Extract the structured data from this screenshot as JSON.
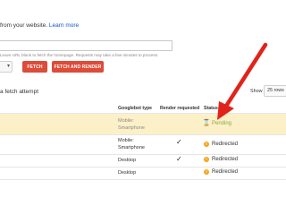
{
  "intro": {
    "text": "from your website.",
    "link": "Learn more"
  },
  "fetch_form": {
    "url_value": "",
    "hint": "Leave URL blank to fetch the homepage. Requests may take a few minutes to process.",
    "device_value": "",
    "fetch_label": "FETCH",
    "fetch_render_label": "FETCH AND RENDER"
  },
  "history": {
    "caption": "a fetch attempt",
    "show_label": "Show",
    "rows_per_page": "25 rows"
  },
  "table": {
    "columns": [
      "Googlebot type",
      "Render requested",
      "Status"
    ],
    "rows": [
      {
        "type_line1": "Mobile:",
        "type_line2": "Smartphone",
        "render": "",
        "status": "Pending",
        "status_kind": "pending"
      },
      {
        "type_line1": "Mobile:",
        "type_line2": "Smartphone",
        "render": "✓",
        "status": "Redirected",
        "status_kind": "warning"
      },
      {
        "type_line1": "Desktop",
        "type_line2": "",
        "render": "✓",
        "status": "Redirected",
        "status_kind": "warning"
      },
      {
        "type_line1": "Desktop",
        "type_line2": "",
        "render": "",
        "status": "Redirected",
        "status_kind": "warning"
      }
    ]
  },
  "icons": {
    "pending": "hourglass-icon",
    "warning": "warning-icon"
  },
  "colors": {
    "accent_red": "#dd4b39",
    "pending_green": "#8aa84a",
    "warning_orange": "#f4a51c",
    "highlight_row": "#fcf0c8",
    "link_blue": "#1155cc"
  }
}
